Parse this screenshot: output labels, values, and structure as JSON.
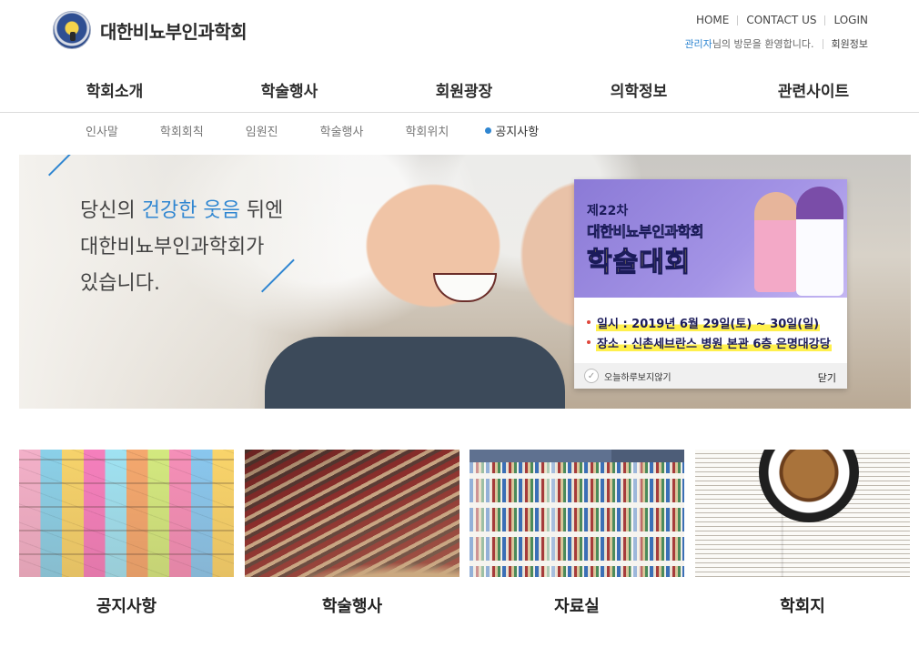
{
  "header": {
    "logo_text": "대한비뇨부인과학회",
    "util_links": [
      "HOME",
      "CONTACT US",
      "LOGIN"
    ],
    "welcome_user": "관리자",
    "welcome_text": "님의 방문을 환영합니다.",
    "member_info": "회원정보"
  },
  "gnb": [
    "학회소개",
    "학술행사",
    "회원광장",
    "의학정보",
    "관련사이트"
  ],
  "lnb": {
    "items": [
      "인사말",
      "학회회칙",
      "임원진",
      "학술행사",
      "학회위치"
    ],
    "active": "공지사항"
  },
  "hero": {
    "line1_pre": "당신의 ",
    "line1_hl": "건강한 웃음",
    "line1_post": " 뒤엔",
    "line2": "대한비뇨부인과학회가",
    "line3": "있습니다."
  },
  "popup": {
    "edition": "제22차",
    "society": "대한비뇨부인과학회",
    "event": "학술대회",
    "date": "일시 :  2019년 6월 29일(토) ~ 30일(일)",
    "place": "장소 :  신촌세브란스 병원 본관 6층 은명대강당",
    "dont_show": "오늘하루보지않기",
    "close": "닫기"
  },
  "cards": [
    {
      "label": "공지사항"
    },
    {
      "label": "학술행사"
    },
    {
      "label": "자료실"
    },
    {
      "label": "학회지"
    }
  ],
  "colors": {
    "accent": "#2f86d1",
    "highlight": "#fff04d"
  }
}
